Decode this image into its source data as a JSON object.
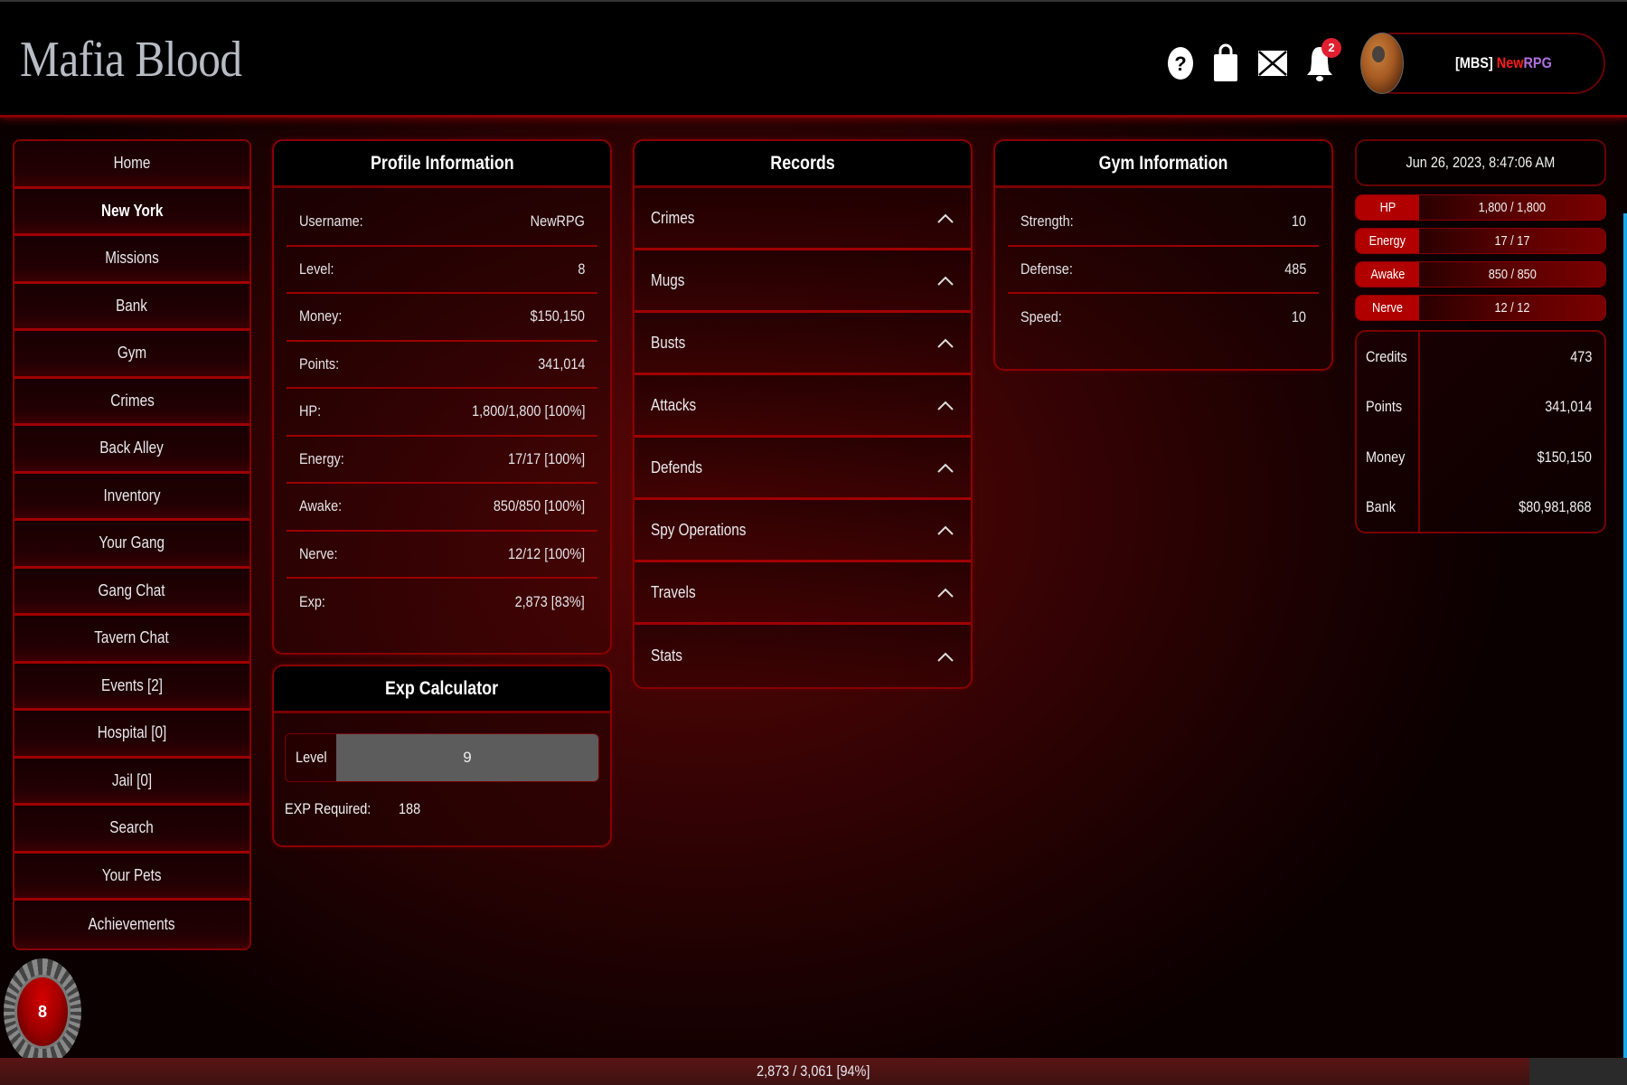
{
  "header": {
    "logo": "Mafia Blood",
    "icons": [
      {
        "name": "help-icon"
      },
      {
        "name": "shop-bag-icon"
      },
      {
        "name": "mail-icon"
      },
      {
        "name": "notification-bell-icon",
        "badge": "2"
      }
    ],
    "user": {
      "tag": "[MBS]",
      "name_part1": "New",
      "name_part2": "RPG"
    }
  },
  "sidebar": {
    "items": [
      {
        "label": "Home"
      },
      {
        "label": "New York",
        "active": true
      },
      {
        "label": "Missions"
      },
      {
        "label": "Bank"
      },
      {
        "label": "Gym"
      },
      {
        "label": "Crimes"
      },
      {
        "label": "Back Alley"
      },
      {
        "label": "Inventory"
      },
      {
        "label": "Your Gang"
      },
      {
        "label": "Gang Chat"
      },
      {
        "label": "Tavern Chat"
      },
      {
        "label": "Events [2]"
      },
      {
        "label": "Hospital [0]"
      },
      {
        "label": "Jail [0]"
      },
      {
        "label": "Search"
      },
      {
        "label": "Your Pets"
      },
      {
        "label": "Achievements"
      }
    ]
  },
  "level_badge": "8",
  "profile": {
    "title": "Profile Information",
    "rows": [
      {
        "label": "Username:",
        "value": "NewRPG"
      },
      {
        "label": "Level:",
        "value": "8"
      },
      {
        "label": "Money:",
        "value": "$150,150"
      },
      {
        "label": "Points:",
        "value": "341,014"
      },
      {
        "label": "HP:",
        "value": "1,800/1,800 [100%]"
      },
      {
        "label": "Energy:",
        "value": "17/17 [100%]"
      },
      {
        "label": "Awake:",
        "value": "850/850 [100%]"
      },
      {
        "label": "Nerve:",
        "value": "12/12 [100%]"
      },
      {
        "label": "Exp:",
        "value": "2,873 [83%]"
      }
    ]
  },
  "exp_calculator": {
    "title": "Exp Calculator",
    "input_label": "Level",
    "input_value": "9",
    "required_label": "EXP Required:",
    "required_value": "188"
  },
  "records": {
    "title": "Records",
    "items": [
      {
        "label": "Crimes"
      },
      {
        "label": "Mugs"
      },
      {
        "label": "Busts"
      },
      {
        "label": "Attacks"
      },
      {
        "label": "Defends"
      },
      {
        "label": "Spy Operations"
      },
      {
        "label": "Travels"
      },
      {
        "label": "Stats"
      }
    ]
  },
  "gym": {
    "title": "Gym Information",
    "rows": [
      {
        "label": "Strength:",
        "value": "10"
      },
      {
        "label": "Defense:",
        "value": "485"
      },
      {
        "label": "Speed:",
        "value": "10"
      }
    ]
  },
  "status": {
    "datetime": "Jun 26, 2023, 8:47:06 AM",
    "bars": [
      {
        "label": "HP",
        "value": "1,800 / 1,800",
        "fraction": 1.0
      },
      {
        "label": "Energy",
        "value": "17 / 17",
        "fraction": 1.0
      },
      {
        "label": "Awake",
        "value": "850 / 850",
        "fraction": 1.0
      },
      {
        "label": "Nerve",
        "value": "12 / 12",
        "fraction": 1.0
      }
    ],
    "resources": [
      {
        "label": "Credits",
        "value": "473"
      },
      {
        "label": "Points",
        "value": "341,014"
      },
      {
        "label": "Money",
        "value": "$150,150"
      },
      {
        "label": "Bank",
        "value": "$80,981,868"
      }
    ]
  },
  "exp_bar": {
    "text": "2,873 / 3,061 [94%]",
    "fraction": 0.94
  },
  "colors": {
    "accent": "#a00000",
    "badge": "#e02030",
    "name_red": "#ff1a1a",
    "name_purple": "#b070e0"
  }
}
